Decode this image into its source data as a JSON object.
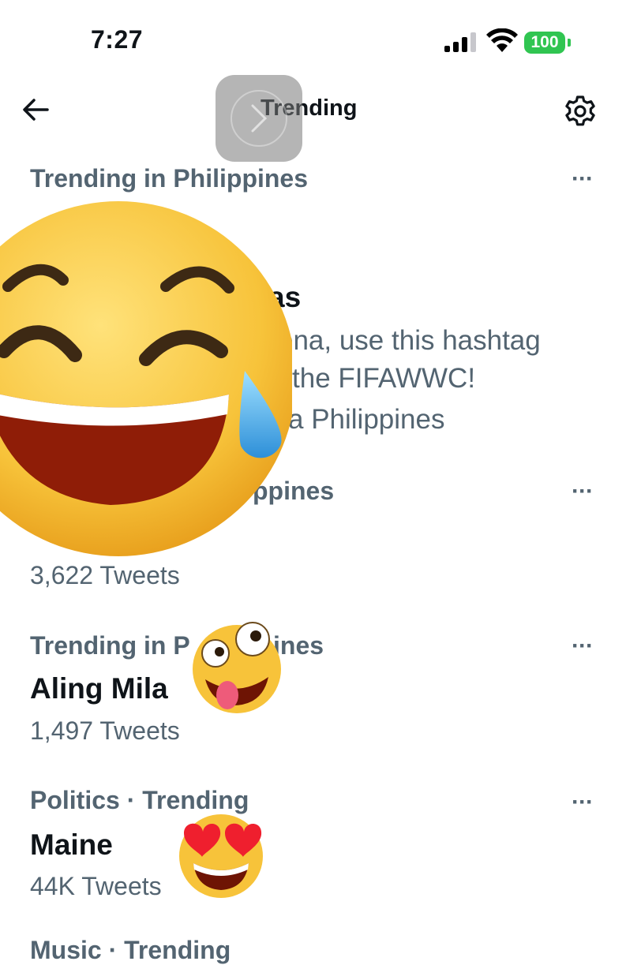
{
  "status_bar": {
    "time": "7:27",
    "battery": "100"
  },
  "header": {
    "title": "Trending",
    "back_icon": "arrow-left-icon",
    "settings_icon": "gear-icon"
  },
  "trends": [
    {
      "meta": "Trending in Philippines",
      "name": "as",
      "description_line1": "ona, use this hashtag",
      "description_line2": "the FIFAWWC!",
      "promoted_by": "a Philippines",
      "more": "···"
    },
    {
      "meta": "ppines",
      "count": "3,622 Tweets",
      "more": "···"
    },
    {
      "meta": "Trending in P",
      "meta_tail": "ines",
      "name": "Aling Mila",
      "count": "1,497 Tweets",
      "more": "···"
    },
    {
      "meta": "Politics · Trending",
      "name": "Maine",
      "count": "44K Tweets",
      "more": "···"
    },
    {
      "meta": "Music · Trending"
    }
  ],
  "colors": {
    "text_primary": "#0f1419",
    "text_secondary": "#536471",
    "battery_green": "#30c551"
  },
  "stickers": [
    "laughing-tears-emoji",
    "zany-face-emoji",
    "heart-eyes-emoji"
  ]
}
